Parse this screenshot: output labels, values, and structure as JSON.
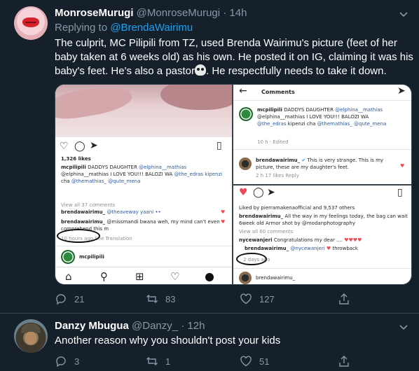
{
  "tweet1": {
    "name": "MonroseMurugi",
    "handle": "@MonroseMurugi",
    "time": "· 14h",
    "replying_prefix": "Replying to",
    "replying_to": "@BrendaWairimu",
    "text_part1": "The culprit,  MC Pilipili from TZ, used Brenda Wairimu's picture (feet of her baby taken at 6 weeks old) as his own. He posted it on IG,  claiming it was his baby's feet. He's also a pastor",
    "text_part2": ". He respectfully needs to take it down.",
    "actions": {
      "replies": "21",
      "retweets": "83",
      "likes": "127"
    }
  },
  "media": {
    "left": {
      "likes": "1,326 likes",
      "caption_user": "mcpilipili",
      "caption_rest": "DADDYS DAUGHTER",
      "caption_tags1": "@elphina__mathias",
      "caption_line2": "@elphina__mathias I LOVE YOU!!! BALOZI WA",
      "caption_tag2": "@the_edras kipenzi",
      "caption_line3a": "cha",
      "caption_tag3": "@themathias_ @qute_mena",
      "view_all": "View all 37 comments",
      "c1_user": "brendawairimu_",
      "c1_text": "@theaveway yaani ••",
      "c2_user": "brendawairimu_",
      "c2_text": "@missmandi bwana weh, my mind can't even",
      "c2_text2": "comprehend this m",
      "c_meta": "10 hours ago  See Translation",
      "profile_user": "mcpilipili"
    },
    "right_top": {
      "header": "Comments",
      "post_user": "mcpilipili",
      "post_text1": "DADDYS DAUGHTER",
      "post_tag1": "@elphina__mathias",
      "post_line2": "@elphina__mathias I LOVE YOU!!! BALOZI WA",
      "post_tag2": "@the_edras",
      "post_line2b": "kipenzi cha",
      "post_tag3": "@themathias_ @qute_mena",
      "post_meta": "10 h · Edited",
      "reply_user": "brendawairimu_",
      "reply_text1": "This is very strange. This is my",
      "reply_text2": "picture, these are my daughter's feet.",
      "reply_meta": "2 h     17 likes    Reply"
    },
    "right_bottom": {
      "liked_by": "Liked by pierramakenaofficial and 9,537 others",
      "c1_user": "brendawairimu_",
      "c1_text": "All the way in my feelings today, the bag can wait",
      "c1_text2": "6week old Armor shot by @modanphotography",
      "view_all": "View all 60 comments",
      "c2_user": "nycewanjeri",
      "c2_text": "Congratulations my dear ....",
      "c3_user": "brendawairimu_",
      "c3_text": "@nycewanjeri",
      "c3_tail": "throwback",
      "meta": "2 days ago",
      "footer_user": "brendawairimu_"
    }
  },
  "tweet2": {
    "name": "Danzy Mbugua",
    "handle": "@Danzy_",
    "time": "· 12h",
    "text": "Another reason why you shouldn't post your kids",
    "actions": {
      "replies": "3",
      "retweets": "1",
      "likes": "51"
    }
  },
  "colors": {
    "background": "#15202b",
    "accent": "#1da1f2",
    "muted": "#8899a6",
    "divider": "#38444d"
  }
}
